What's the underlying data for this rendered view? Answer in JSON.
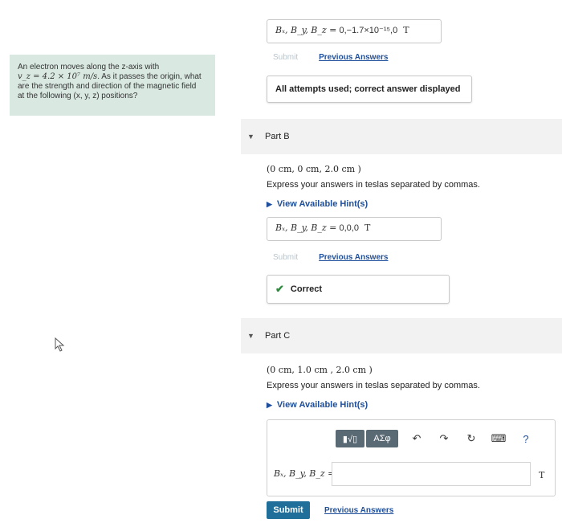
{
  "problem": {
    "text_line1": "An electron moves along the z-axis with",
    "velocity_expr": "v_z = 4.2 × 10⁷ m/s",
    "text_line2_rest": ". As it passes the origin, what",
    "text_line3": "are the strength and direction of the magnetic field",
    "text_line4": "at the following (x, y, z) positions?"
  },
  "part_a": {
    "answer_label": "Bₓ, B_y, B_z =",
    "answer_value": "0,−1.7×10⁻¹⁵,0",
    "answer_unit": "T",
    "submit_label": "Submit",
    "previous_answers_label": "Previous Answers",
    "feedback": "All attempts used; correct answer displayed"
  },
  "part_b": {
    "title": "Part B",
    "coords": "(0 cm, 0 cm, 2.0 cm )",
    "instruction": "Express your answers in teslas separated by commas.",
    "hint_label": "View Available Hint(s)",
    "answer_label": "Bₓ, B_y, B_z =",
    "answer_value": "0,0,0",
    "answer_unit": "T",
    "submit_label": "Submit",
    "previous_answers_label": "Previous Answers",
    "feedback": "Correct"
  },
  "part_c": {
    "title": "Part C",
    "coords": "(0 cm, 1.0 cm , 2.0 cm )",
    "instruction": "Express your answers in teslas separated by commas.",
    "hint_label": "View Available Hint(s)",
    "toolbar": {
      "templates_label": "▮√▯",
      "symbols_label": "ΑΣφ",
      "undo": "↶",
      "redo": "↷",
      "reset": "↻",
      "keyboard": "⌨",
      "help": "?"
    },
    "answer_label": "Bₓ, B_y, B_z =",
    "answer_value": "",
    "answer_unit": "T",
    "submit_label": "Submit",
    "previous_answers_label": "Previous Answers"
  }
}
